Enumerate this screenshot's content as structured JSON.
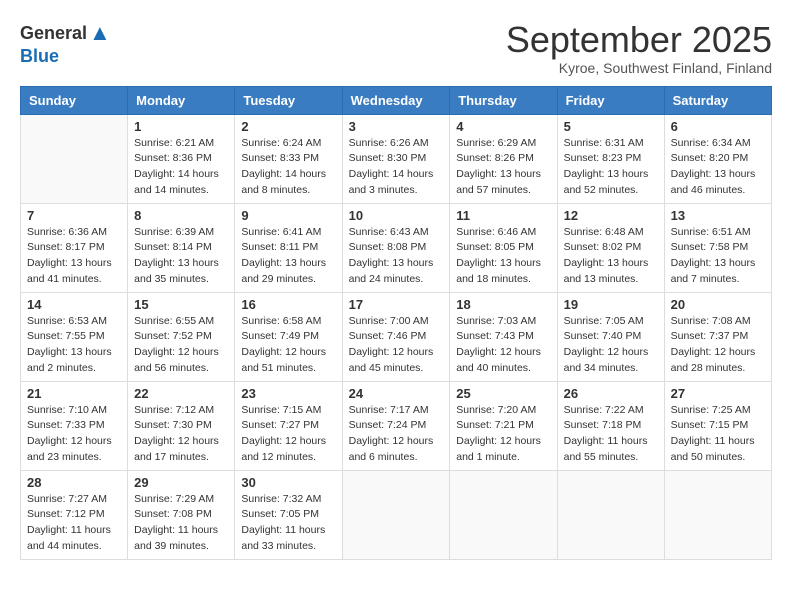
{
  "header": {
    "logo_general": "General",
    "logo_blue": "Blue",
    "title": "September 2025",
    "location": "Kyroe, Southwest Finland, Finland"
  },
  "weekdays": [
    "Sunday",
    "Monday",
    "Tuesday",
    "Wednesday",
    "Thursday",
    "Friday",
    "Saturday"
  ],
  "weeks": [
    [
      {
        "day": "",
        "info": ""
      },
      {
        "day": "1",
        "info": "Sunrise: 6:21 AM\nSunset: 8:36 PM\nDaylight: 14 hours\nand 14 minutes."
      },
      {
        "day": "2",
        "info": "Sunrise: 6:24 AM\nSunset: 8:33 PM\nDaylight: 14 hours\nand 8 minutes."
      },
      {
        "day": "3",
        "info": "Sunrise: 6:26 AM\nSunset: 8:30 PM\nDaylight: 14 hours\nand 3 minutes."
      },
      {
        "day": "4",
        "info": "Sunrise: 6:29 AM\nSunset: 8:26 PM\nDaylight: 13 hours\nand 57 minutes."
      },
      {
        "day": "5",
        "info": "Sunrise: 6:31 AM\nSunset: 8:23 PM\nDaylight: 13 hours\nand 52 minutes."
      },
      {
        "day": "6",
        "info": "Sunrise: 6:34 AM\nSunset: 8:20 PM\nDaylight: 13 hours\nand 46 minutes."
      }
    ],
    [
      {
        "day": "7",
        "info": "Sunrise: 6:36 AM\nSunset: 8:17 PM\nDaylight: 13 hours\nand 41 minutes."
      },
      {
        "day": "8",
        "info": "Sunrise: 6:39 AM\nSunset: 8:14 PM\nDaylight: 13 hours\nand 35 minutes."
      },
      {
        "day": "9",
        "info": "Sunrise: 6:41 AM\nSunset: 8:11 PM\nDaylight: 13 hours\nand 29 minutes."
      },
      {
        "day": "10",
        "info": "Sunrise: 6:43 AM\nSunset: 8:08 PM\nDaylight: 13 hours\nand 24 minutes."
      },
      {
        "day": "11",
        "info": "Sunrise: 6:46 AM\nSunset: 8:05 PM\nDaylight: 13 hours\nand 18 minutes."
      },
      {
        "day": "12",
        "info": "Sunrise: 6:48 AM\nSunset: 8:02 PM\nDaylight: 13 hours\nand 13 minutes."
      },
      {
        "day": "13",
        "info": "Sunrise: 6:51 AM\nSunset: 7:58 PM\nDaylight: 13 hours\nand 7 minutes."
      }
    ],
    [
      {
        "day": "14",
        "info": "Sunrise: 6:53 AM\nSunset: 7:55 PM\nDaylight: 13 hours\nand 2 minutes."
      },
      {
        "day": "15",
        "info": "Sunrise: 6:55 AM\nSunset: 7:52 PM\nDaylight: 12 hours\nand 56 minutes."
      },
      {
        "day": "16",
        "info": "Sunrise: 6:58 AM\nSunset: 7:49 PM\nDaylight: 12 hours\nand 51 minutes."
      },
      {
        "day": "17",
        "info": "Sunrise: 7:00 AM\nSunset: 7:46 PM\nDaylight: 12 hours\nand 45 minutes."
      },
      {
        "day": "18",
        "info": "Sunrise: 7:03 AM\nSunset: 7:43 PM\nDaylight: 12 hours\nand 40 minutes."
      },
      {
        "day": "19",
        "info": "Sunrise: 7:05 AM\nSunset: 7:40 PM\nDaylight: 12 hours\nand 34 minutes."
      },
      {
        "day": "20",
        "info": "Sunrise: 7:08 AM\nSunset: 7:37 PM\nDaylight: 12 hours\nand 28 minutes."
      }
    ],
    [
      {
        "day": "21",
        "info": "Sunrise: 7:10 AM\nSunset: 7:33 PM\nDaylight: 12 hours\nand 23 minutes."
      },
      {
        "day": "22",
        "info": "Sunrise: 7:12 AM\nSunset: 7:30 PM\nDaylight: 12 hours\nand 17 minutes."
      },
      {
        "day": "23",
        "info": "Sunrise: 7:15 AM\nSunset: 7:27 PM\nDaylight: 12 hours\nand 12 minutes."
      },
      {
        "day": "24",
        "info": "Sunrise: 7:17 AM\nSunset: 7:24 PM\nDaylight: 12 hours\nand 6 minutes."
      },
      {
        "day": "25",
        "info": "Sunrise: 7:20 AM\nSunset: 7:21 PM\nDaylight: 12 hours\nand 1 minute."
      },
      {
        "day": "26",
        "info": "Sunrise: 7:22 AM\nSunset: 7:18 PM\nDaylight: 11 hours\nand 55 minutes."
      },
      {
        "day": "27",
        "info": "Sunrise: 7:25 AM\nSunset: 7:15 PM\nDaylight: 11 hours\nand 50 minutes."
      }
    ],
    [
      {
        "day": "28",
        "info": "Sunrise: 7:27 AM\nSunset: 7:12 PM\nDaylight: 11 hours\nand 44 minutes."
      },
      {
        "day": "29",
        "info": "Sunrise: 7:29 AM\nSunset: 7:08 PM\nDaylight: 11 hours\nand 39 minutes."
      },
      {
        "day": "30",
        "info": "Sunrise: 7:32 AM\nSunset: 7:05 PM\nDaylight: 11 hours\nand 33 minutes."
      },
      {
        "day": "",
        "info": ""
      },
      {
        "day": "",
        "info": ""
      },
      {
        "day": "",
        "info": ""
      },
      {
        "day": "",
        "info": ""
      }
    ]
  ]
}
